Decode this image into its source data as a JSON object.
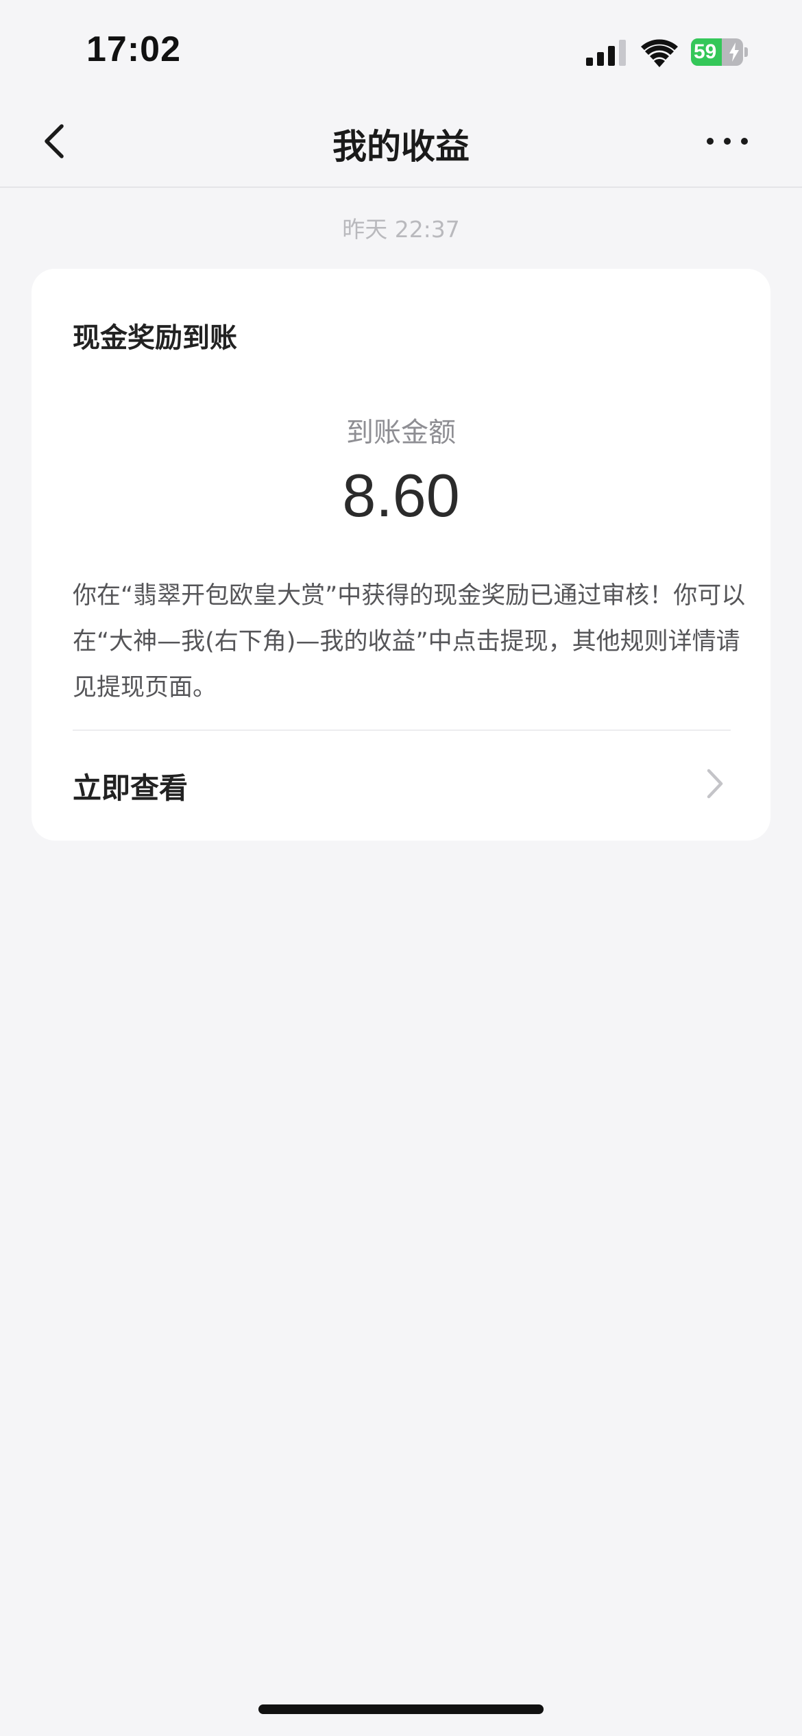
{
  "status_bar": {
    "time": "17:02",
    "battery_level": "59",
    "battery_fraction": 0.59
  },
  "nav": {
    "title": "我的收益",
    "back_icon": "chevron-left-icon",
    "more_icon": "more-icon"
  },
  "message": {
    "timestamp": "昨天 22:37",
    "card": {
      "title": "现金奖励到账",
      "amount_label": "到账金额",
      "amount": "8.60",
      "description": "你在“翡翠开包欧皇大赏”中获得的现金奖励已通过审核！你可以在“大神—我(右下角)—我的收益”中点击提现，其他规则详情请见提现页面。",
      "action_label": "立即查看"
    }
  },
  "colors": {
    "background": "#f5f5f7",
    "card": "#ffffff",
    "battery_green": "#34c759"
  }
}
